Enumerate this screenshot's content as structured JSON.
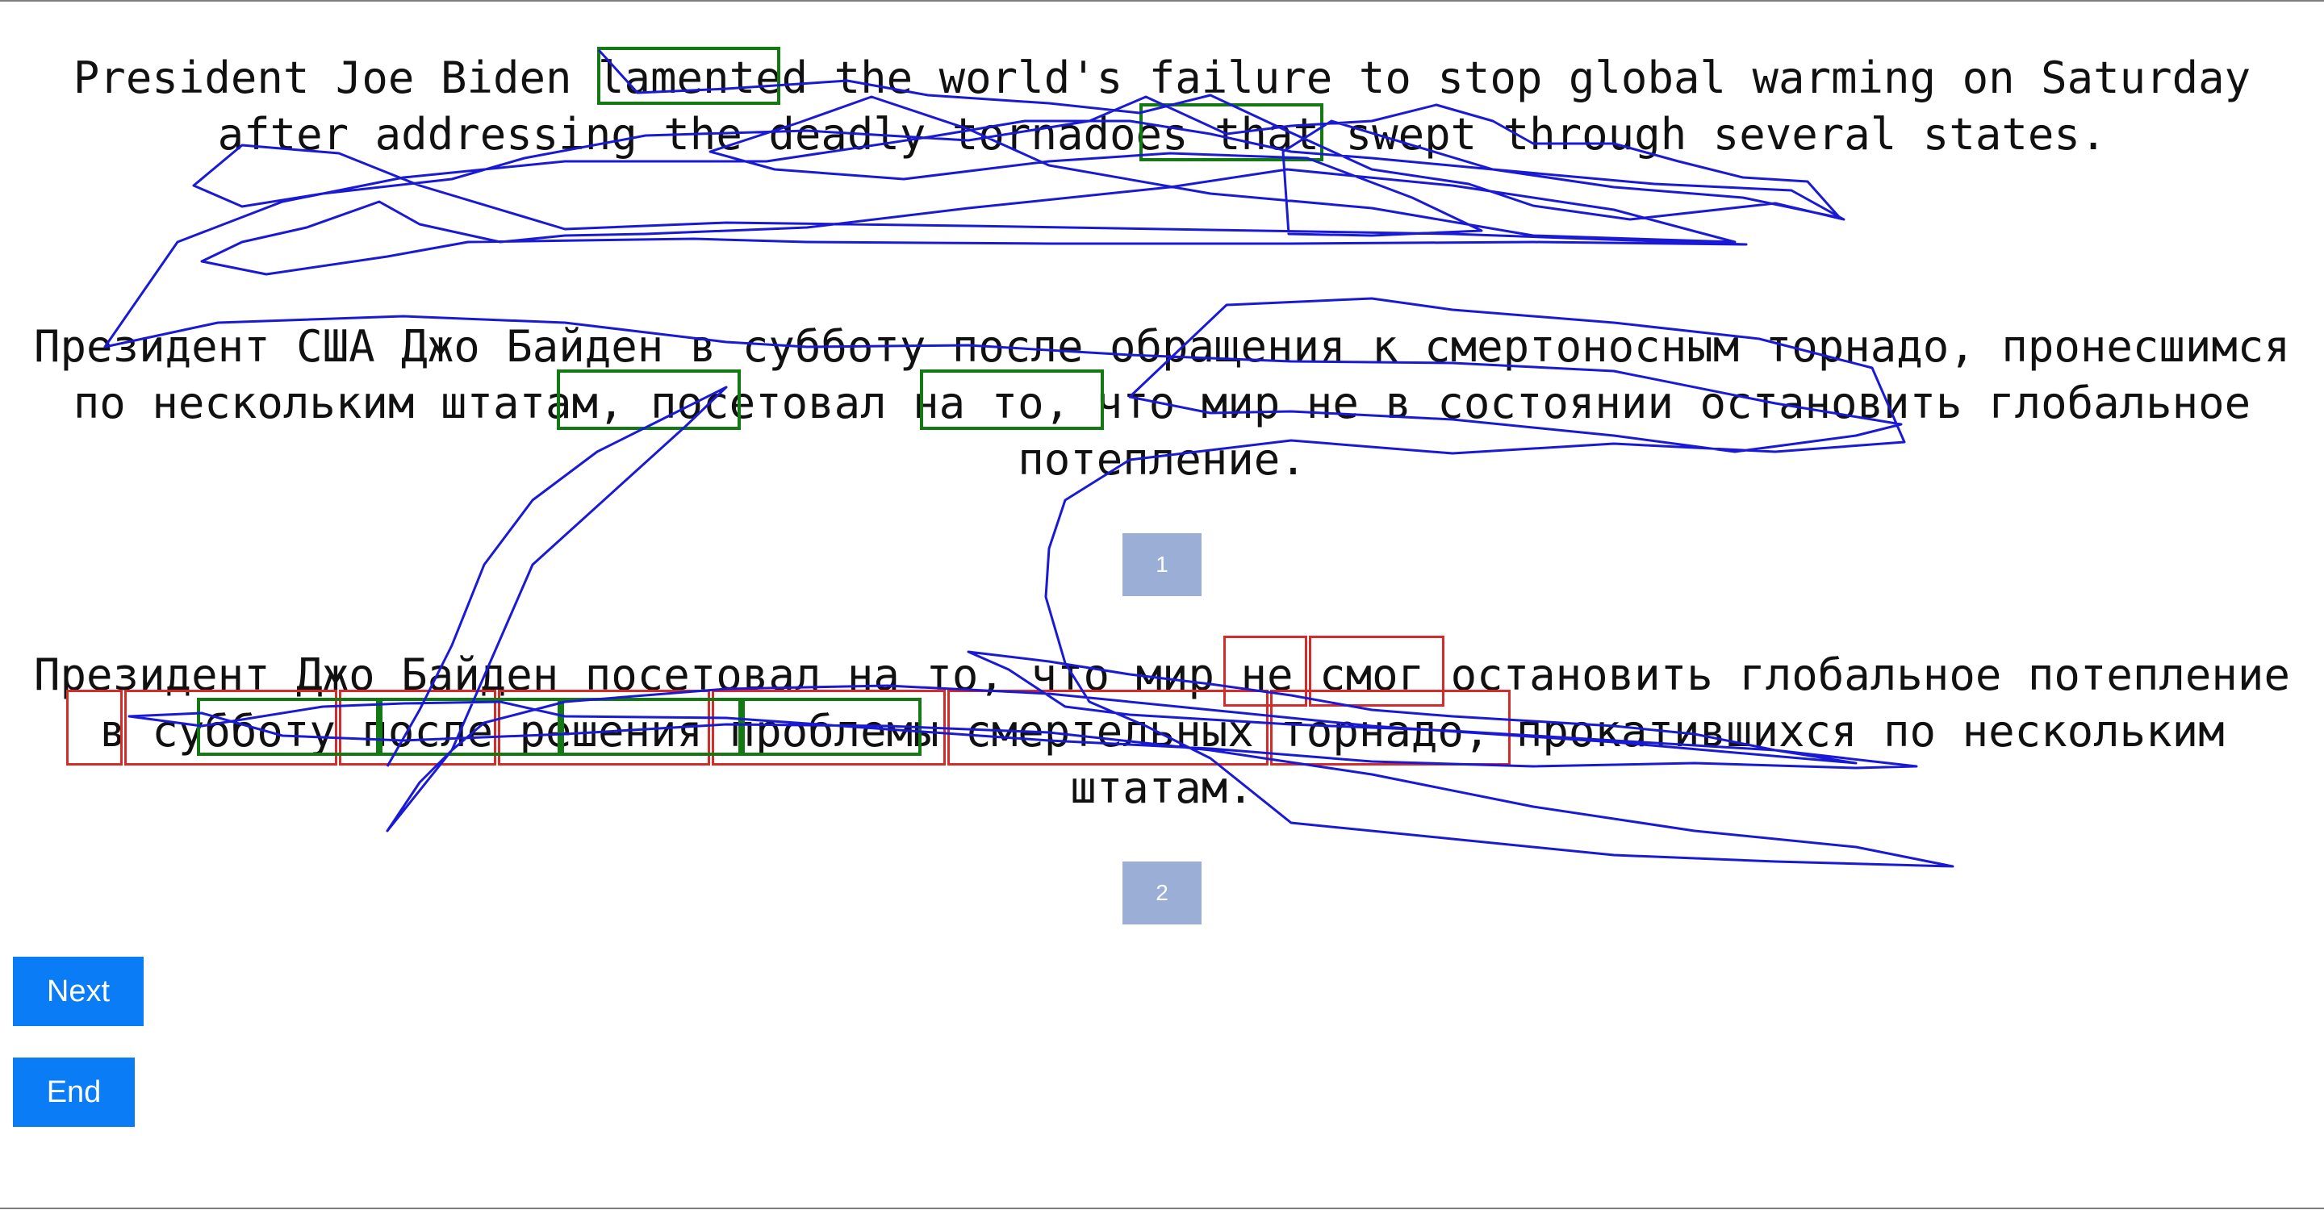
{
  "sentences": {
    "source": {
      "lines": [
        "President Joe Biden lamented the world's failure to stop global warming on Saturday",
        "after addressing the deadly tornadoes that swept through several states."
      ]
    },
    "reference": {
      "lines": [
        "Президент США Джо Байден в субботу после обращения к смертоносным торнадо, пронесшимся",
        "по нескольким штатам, посетовал на то, что мир не в состоянии остановить глобальное",
        "потепление."
      ]
    },
    "translation": {
      "lines": [
        "Президент Джо Байден посетовал на то, что мир не смог остановить глобальное потепление",
        "в субботу после решения проблемы смертельных торнадо, прокатившихся по нескольким",
        "штатам."
      ]
    }
  },
  "chips": [
    "1",
    "2"
  ],
  "buttons": {
    "next": "Next",
    "end": "End"
  },
  "colors": {
    "green_box": "#137a13",
    "red_box": "#d42b2b",
    "gaze_trace": "#1a1ad6",
    "chip": "#9aaed6",
    "button": "#0a7cf5"
  }
}
